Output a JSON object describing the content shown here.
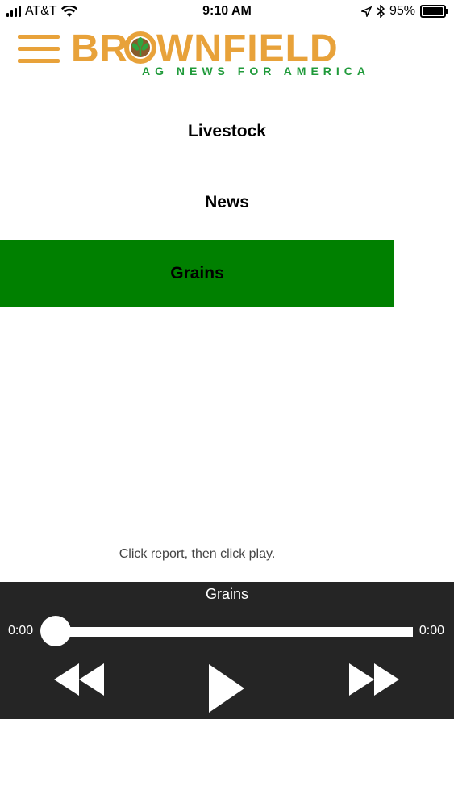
{
  "status_bar": {
    "carrier": "AT&T",
    "time": "9:10 AM",
    "battery": "95%",
    "battery_level": 0.95,
    "icons": [
      "signal-icon",
      "wifi-icon",
      "location-icon",
      "bluetooth-icon",
      "battery-icon"
    ]
  },
  "header": {
    "menu_icon": "hamburger-icon",
    "logo_text": "BROWNFIELD",
    "logo_tagline": "AG NEWS FOR AMERICA",
    "colors": {
      "brand_orange": "#e8a23a",
      "brand_green": "#1f9a3a"
    }
  },
  "categories": [
    {
      "label": "Livestock",
      "active": false
    },
    {
      "label": "News",
      "active": false
    },
    {
      "label": "Grains",
      "active": true
    }
  ],
  "active_color": "#008000",
  "hint": "Click report, then click play.",
  "player": {
    "title": "Grains",
    "current_time": "0:00",
    "total_time": "0:00",
    "progress": 0,
    "controls": [
      "rewind-icon",
      "play-icon",
      "fast-forward-icon"
    ],
    "background": "#252525"
  }
}
